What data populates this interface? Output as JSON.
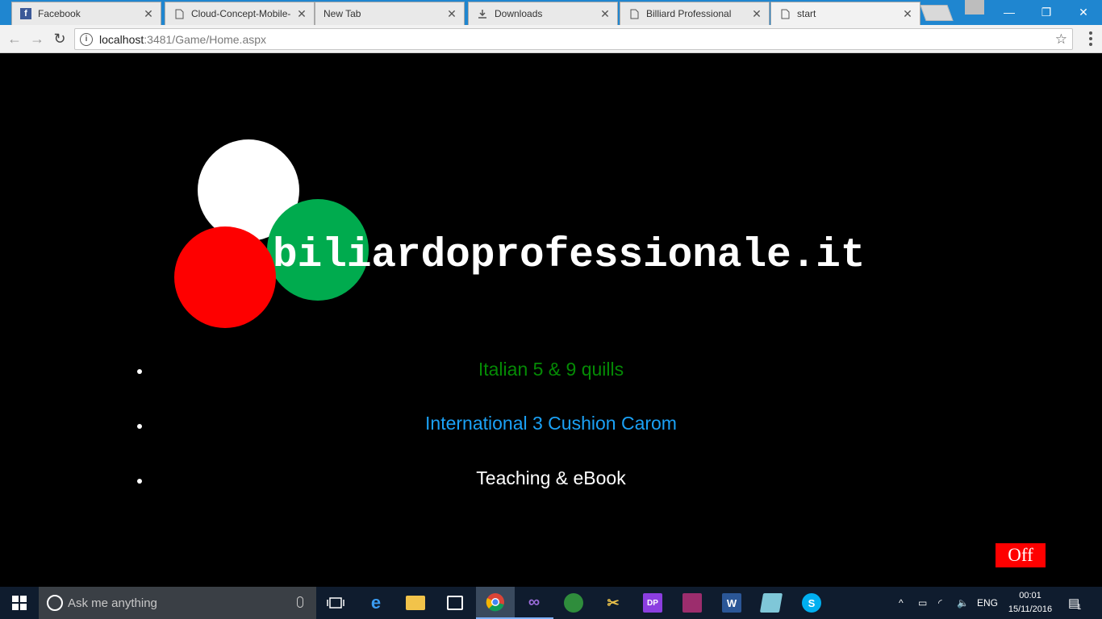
{
  "browser": {
    "tabs": [
      {
        "title": "Facebook",
        "icon": "facebook-icon"
      },
      {
        "title": "Cloud-Concept-Mobile-",
        "icon": "page-icon"
      },
      {
        "title": "New Tab",
        "icon": "none"
      },
      {
        "title": "Downloads",
        "icon": "download-icon"
      },
      {
        "title": "Billiard Professional",
        "icon": "page-icon"
      },
      {
        "title": "start",
        "icon": "page-icon"
      }
    ],
    "address": {
      "host": "localhost",
      "path": ":3481/Game/Home.aspx"
    }
  },
  "page": {
    "site_title": "biliardoprofessionale.it",
    "menu": [
      {
        "label": "Italian 5 & 9 quills",
        "color": "#058a05"
      },
      {
        "label": "International 3 Cushion Carom",
        "color": "#1ba1f5"
      },
      {
        "label": "Teaching & eBook",
        "color": "#ffffff"
      }
    ],
    "off_label": "Off",
    "colors": {
      "ball_white": "#ffffff",
      "ball_green": "#00ab4e",
      "ball_red": "#fe0000"
    }
  },
  "taskbar": {
    "search_placeholder": "Ask me anything",
    "apps": [
      "task-view-icon",
      "edge-icon",
      "file-explorer-icon",
      "store-icon",
      "chrome-icon",
      "visual-studio-icon",
      "ie-download-icon",
      "tools-icon",
      "dotpeek-icon",
      "winrar-icon",
      "word-icon",
      "notes-icon",
      "skype-icon"
    ],
    "language": "ENG",
    "time": "00:01",
    "date": "15/11/2016",
    "notification_count": "1"
  }
}
